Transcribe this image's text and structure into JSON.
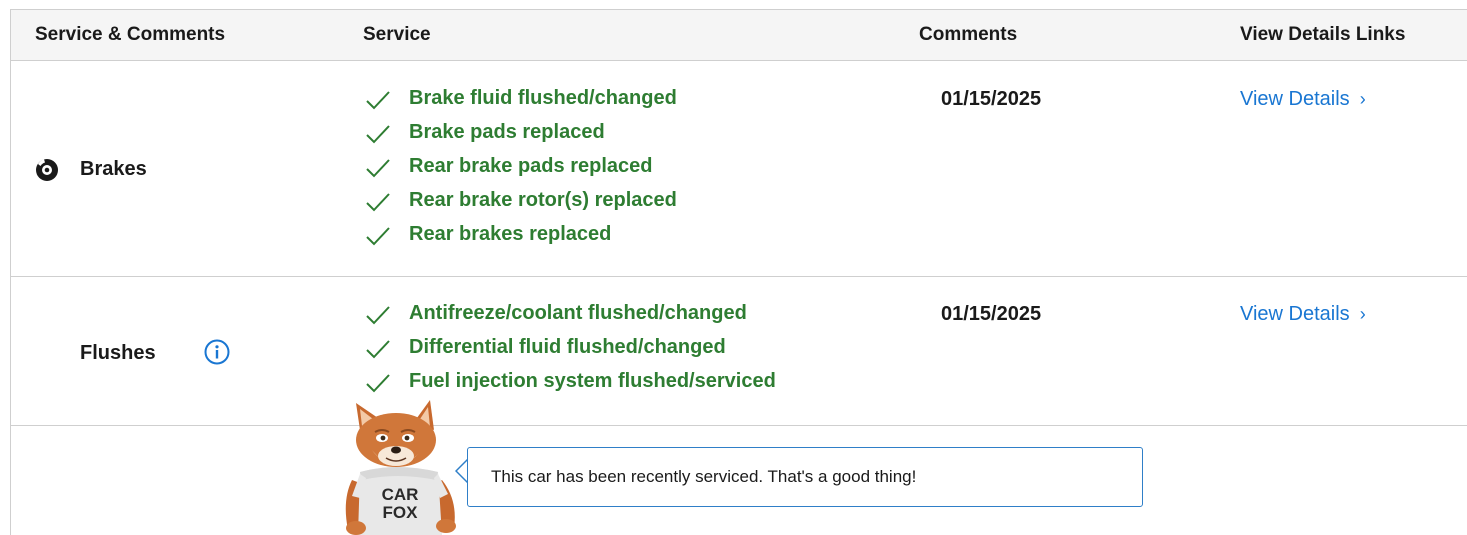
{
  "header": {
    "col_service_comments": "Service & Comments",
    "col_service": "Service",
    "col_comments": "Comments",
    "col_view_details": "View Details Links"
  },
  "rows": [
    {
      "name": "Brakes",
      "icon": "brake-disc-icon",
      "services": [
        "Brake fluid flushed/changed",
        "Brake pads replaced",
        "Rear brake pads replaced",
        "Rear brake rotor(s) replaced",
        "Rear brakes replaced"
      ],
      "comment": "01/15/2025",
      "link_label": "View Details",
      "link_chevron": "›"
    },
    {
      "name": "Flushes",
      "icon": "info-icon",
      "services": [
        "Antifreeze/coolant flushed/changed",
        "Differential fluid flushed/changed",
        "Fuel injection system flushed/serviced"
      ],
      "comment": "01/15/2025",
      "link_label": "View Details",
      "link_chevron": "›"
    }
  ],
  "mascot": {
    "shirt_line1": "CAR",
    "shirt_line2": "FOX",
    "message": "This car has been recently serviced. That's a good thing!"
  },
  "colors": {
    "service_green": "#2e7d32",
    "link_blue": "#1976d2",
    "bubble_border": "#2f7fc8",
    "header_bg": "#f5f5f5",
    "border": "#cfcfcf"
  }
}
